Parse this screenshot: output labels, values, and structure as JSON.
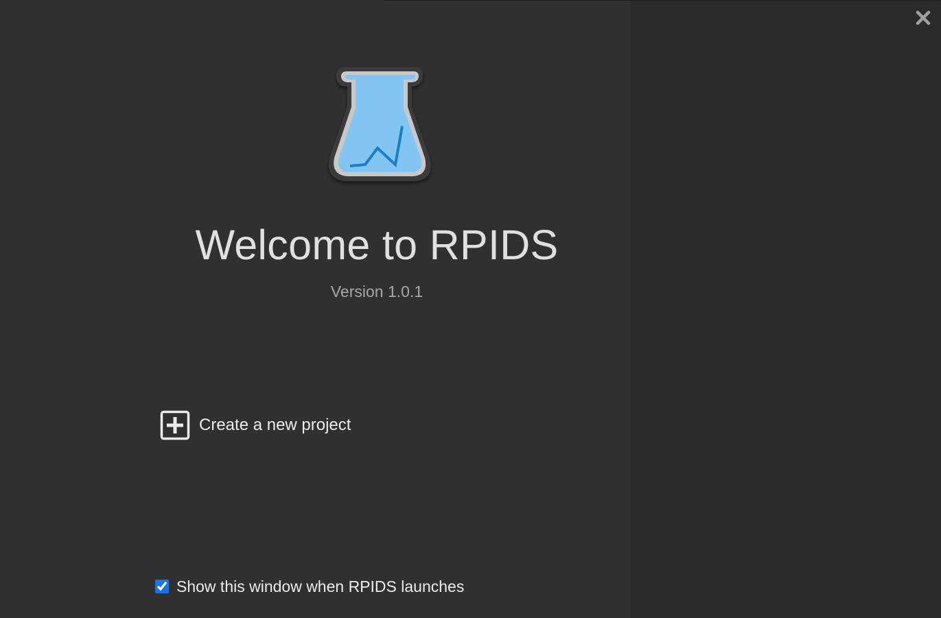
{
  "window": {
    "close_icon": "close-icon",
    "close_color": "#a0a0a0"
  },
  "logo": {
    "icon": "flask-chart-icon",
    "liquid_color": "#83c5f2",
    "line_color": "#1a7fc8",
    "rim_color": "#c8c8c8"
  },
  "welcome": {
    "title": "Welcome to RPIDS",
    "version": "Version 1.0.1"
  },
  "actions": {
    "create_project_icon": "plus-square-icon",
    "create_project_label": "Create a new project"
  },
  "footer": {
    "show_on_launch_label": "Show this window when RPIDS launches",
    "show_on_launch_checked": true
  }
}
